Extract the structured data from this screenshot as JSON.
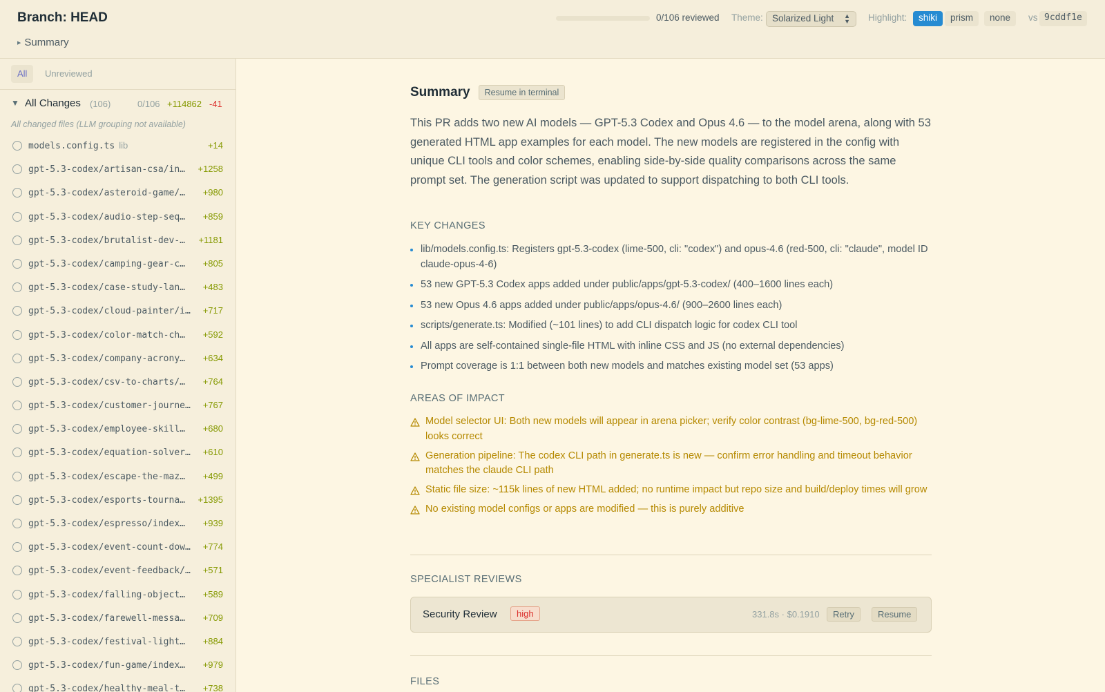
{
  "header": {
    "branch_title": "Branch: HEAD",
    "summary_toggle": "Summary",
    "progress": {
      "reviewed": 0,
      "total": 106,
      "text": "0/106 reviewed"
    },
    "theme_label": "Theme:",
    "theme_value": "Solarized Light",
    "highlight_label": "Highlight:",
    "highlight_options": [
      "shiki",
      "prism",
      "none"
    ],
    "highlight_selected": "shiki",
    "vs_label": "vs",
    "vs_hash": "9cddf1e"
  },
  "sidebar": {
    "tabs": [
      "All",
      "Unreviewed"
    ],
    "active_tab": "All",
    "all_changes": {
      "label": "All Changes",
      "count": "(106)",
      "reviewed": "0/106",
      "additions": "+114862",
      "deletions": "-41"
    },
    "group_note": "All changed files (LLM grouping not available)",
    "files": [
      {
        "name": "models.config.ts",
        "tag": "lib",
        "additions": "+14"
      },
      {
        "name": "gpt-5.3-codex/artisan-csa/in…",
        "tag": "",
        "additions": "+1258"
      },
      {
        "name": "gpt-5.3-codex/asteroid-game/…",
        "tag": "",
        "additions": "+980"
      },
      {
        "name": "gpt-5.3-codex/audio-step-seq…",
        "tag": "",
        "additions": "+859"
      },
      {
        "name": "gpt-5.3-codex/brutalist-dev-…",
        "tag": "",
        "additions": "+1181"
      },
      {
        "name": "gpt-5.3-codex/camping-gear-c…",
        "tag": "",
        "additions": "+805"
      },
      {
        "name": "gpt-5.3-codex/case-study-lan…",
        "tag": "",
        "additions": "+483"
      },
      {
        "name": "gpt-5.3-codex/cloud-painter/i…",
        "tag": "",
        "additions": "+717"
      },
      {
        "name": "gpt-5.3-codex/color-match-ch…",
        "tag": "",
        "additions": "+592"
      },
      {
        "name": "gpt-5.3-codex/company-acrony…",
        "tag": "",
        "additions": "+634"
      },
      {
        "name": "gpt-5.3-codex/csv-to-charts/…",
        "tag": "",
        "additions": "+764"
      },
      {
        "name": "gpt-5.3-codex/customer-journe…",
        "tag": "",
        "additions": "+767"
      },
      {
        "name": "gpt-5.3-codex/employee-skill…",
        "tag": "",
        "additions": "+680"
      },
      {
        "name": "gpt-5.3-codex/equation-solver…",
        "tag": "",
        "additions": "+610"
      },
      {
        "name": "gpt-5.3-codex/escape-the-maz…",
        "tag": "",
        "additions": "+499"
      },
      {
        "name": "gpt-5.3-codex/esports-tourna…",
        "tag": "",
        "additions": "+1395"
      },
      {
        "name": "gpt-5.3-codex/espresso/index…",
        "tag": "",
        "additions": "+939"
      },
      {
        "name": "gpt-5.3-codex/event-count-dow…",
        "tag": "",
        "additions": "+774"
      },
      {
        "name": "gpt-5.3-codex/event-feedback/…",
        "tag": "",
        "additions": "+571"
      },
      {
        "name": "gpt-5.3-codex/falling-object…",
        "tag": "",
        "additions": "+589"
      },
      {
        "name": "gpt-5.3-codex/farewell-messa…",
        "tag": "",
        "additions": "+709"
      },
      {
        "name": "gpt-5.3-codex/festival-light…",
        "tag": "",
        "additions": "+884"
      },
      {
        "name": "gpt-5.3-codex/fun-game/index…",
        "tag": "",
        "additions": "+979"
      },
      {
        "name": "gpt-5.3-codex/healthy-meal-t…",
        "tag": "",
        "additions": "+738"
      }
    ]
  },
  "main": {
    "summary_title": "Summary",
    "resume_terminal": "Resume in terminal",
    "summary_text": "This PR adds two new AI models — GPT-5.3 Codex and Opus 4.6 — to the model arena, along with 53 generated HTML app examples for each model. The new models are registered in the config with unique CLI tools and color schemes, enabling side-by-side quality comparisons across the same prompt set. The generation script was updated to support dispatching to both CLI tools.",
    "key_changes_title": "KEY CHANGES",
    "key_changes": [
      "lib/models.config.ts: Registers gpt-5.3-codex (lime-500, cli: \"codex\") and opus-4.6 (red-500, cli: \"claude\", model ID claude-opus-4-6)",
      "53 new GPT-5.3 Codex apps added under public/apps/gpt-5.3-codex/ (400–1600 lines each)",
      "53 new Opus 4.6 apps added under public/apps/opus-4.6/ (900–2600 lines each)",
      "scripts/generate.ts: Modified (~101 lines) to add CLI dispatch logic for codex CLI tool",
      "All apps are self-contained single-file HTML with inline CSS and JS (no external dependencies)",
      "Prompt coverage is 1:1 between both new models and matches existing model set (53 apps)"
    ],
    "impact_title": "AREAS OF IMPACT",
    "impacts": [
      "Model selector UI: Both new models will appear in arena picker; verify color contrast (bg-lime-500, bg-red-500) looks correct",
      "Generation pipeline: The codex CLI path in generate.ts is new — confirm error handling and timeout behavior matches the claude CLI path",
      "Static file size: ~115k lines of new HTML added; no runtime impact but repo size and build/deploy times will grow",
      "No existing model configs or apps are modified — this is purely additive"
    ],
    "specialist_title": "SPECIALIST REVIEWS",
    "specialist": {
      "name": "Security Review",
      "severity": "high",
      "meta": "331.8s · $0.1910",
      "retry": "Retry",
      "resume": "Resume"
    },
    "files_title": "FILES"
  },
  "colors": {
    "background": "#fdf6e3",
    "accent_blue": "#268bd2",
    "addition_green": "#859900",
    "deletion_red": "#dc322f",
    "warning_yellow": "#b58900",
    "violet": "#6c71c4"
  },
  "icons": {
    "collapse": "triangle-down-icon",
    "expand": "triangle-right-icon",
    "unreviewed": "empty-circle-icon",
    "warning": "warning-triangle-icon",
    "bullet": "bullet-dot-icon",
    "select": "select-arrows-icon"
  }
}
